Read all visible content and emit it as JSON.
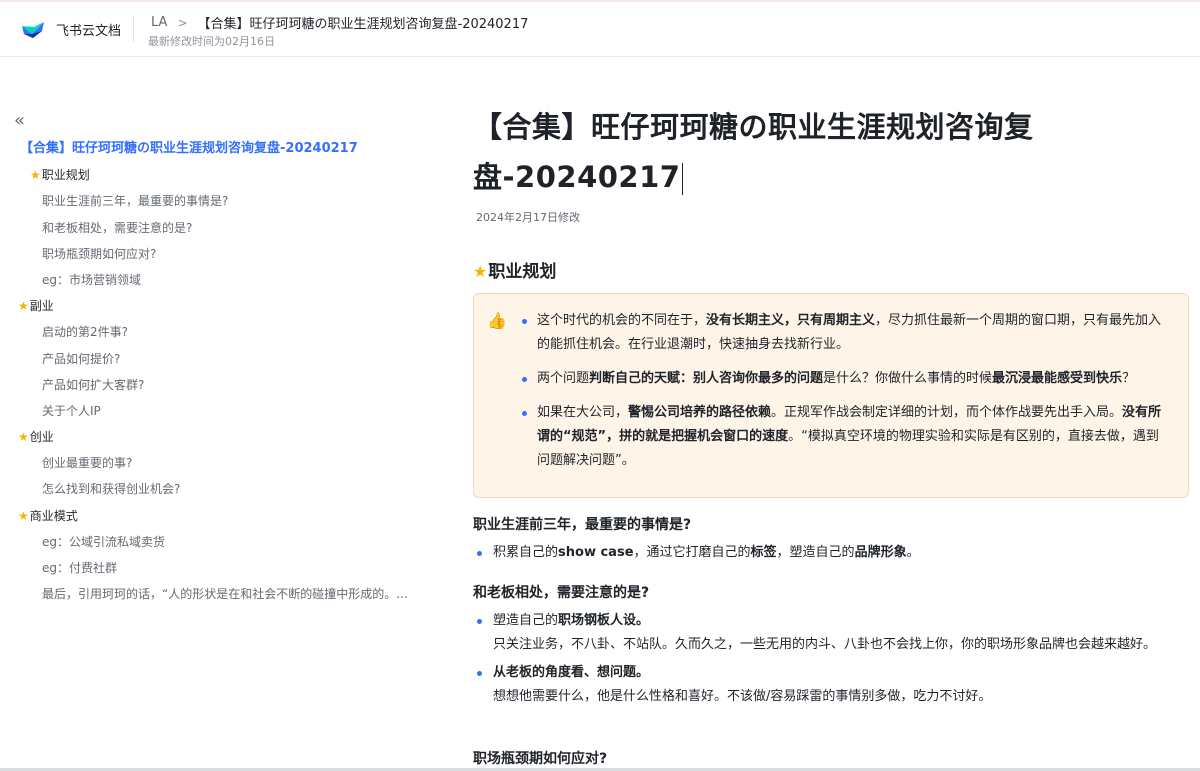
{
  "header": {
    "app_name": "飞书云文档",
    "breadcrumb_root": "LA",
    "breadcrumb_separator": ">",
    "breadcrumb_current": "【合集】旺仔珂珂糖の职业生涯规划咨询复盘-20240217",
    "modified": "最新修改时间为02月16日"
  },
  "toc": {
    "collapse_icon": "«",
    "items": [
      {
        "label": "【合集】旺仔珂珂糖の职业生涯规划咨询复盘-20240217",
        "level": 0
      },
      {
        "label": "职业规划",
        "level": 1,
        "star": true
      },
      {
        "label": "职业生涯前三年，最重要的事情是?",
        "level": 2
      },
      {
        "label": "和老板相处，需要注意的是?",
        "level": 2
      },
      {
        "label": "职场瓶颈期如何应对?",
        "level": 2
      },
      {
        "label": "eg：市场营销领域",
        "level": 2
      },
      {
        "label": "副业",
        "level": 1,
        "star": true
      },
      {
        "label": "启动的第2件事?",
        "level": 2
      },
      {
        "label": "产品如何提价?",
        "level": 2
      },
      {
        "label": "产品如何扩大客群?",
        "level": 2
      },
      {
        "label": "关于个人IP",
        "level": 2
      },
      {
        "label": "创业",
        "level": 1,
        "star": true
      },
      {
        "label": "创业最重要的事?",
        "level": 2
      },
      {
        "label": "怎么找到和获得创业机会?",
        "level": 2
      },
      {
        "label": "商业模式",
        "level": 1,
        "star": true
      },
      {
        "label": "eg：公域引流私域卖货",
        "level": 2
      },
      {
        "label": "eg：付费社群",
        "level": 2
      },
      {
        "label": "最后，引用珂珂的话，“人的形状是在和社会不断的碰撞中形成的。...",
        "level": 2
      }
    ]
  },
  "doc": {
    "title_line1": "【合集】旺仔珂珂糖の职业生涯规划咨询复",
    "title_line2": "盘-20240217",
    "date": "2024年2月17日修改",
    "section_title": "职业规划",
    "callout_icon": "👍",
    "callout": [
      {
        "t1": "这个时代的机会的不同在于，",
        "b1": "没有长期主义，只有周期主义",
        "t2": "，尽力抓住最新一个周期的窗口期，只有最先加入的能抓住机会。在行业退潮时，快速抽身去找新行业。"
      },
      {
        "t1": "两个问题",
        "b1": "判断自己的天赋：别人咨询你最多的问题",
        "t2": "是什么？你做什么事情的时候",
        "b2": "最沉浸最能感受到快乐",
        "t3": "？"
      },
      {
        "t1": "如果在大公司，",
        "b1": "警惕公司培养的路径依赖",
        "t2": "。正规军作战会制定详细的计划，而个体作战要先出手入局。",
        "b2": "没有所谓的“规范”，拼的就是把握机会窗口的速度",
        "t3": "。“模拟真空环境的物理实验和实际是有区别的，直接去做，遇到问题解决问题”。"
      }
    ],
    "s1": {
      "heading": "职业生涯前三年，最重要的事情是?",
      "t1": "积累自己的",
      "b1": "show case",
      "t2": "，通过它打磨自己的",
      "b2": "标签",
      "t3": "，塑造自己的",
      "b3": "品牌形象",
      "t4": "。"
    },
    "s2": {
      "heading": "和老板相处，需要注意的是?",
      "i1_t": "塑造自己的",
      "i1_b": "职场钢板人设",
      "i1_end": "。",
      "i1_sub": "只关注业务，不八卦、不站队。久而久之，一些无用的内斗、八卦也不会找上你，你的职场形象品牌也会越来越好。",
      "i2_b": "从老板的角度看、想问题",
      "i2_end": "。",
      "i2_sub": "想想他需要什么，他是什么性格和喜好。不该做/容易踩雷的事情别多做，吃力不讨好。"
    },
    "s3": {
      "heading": "职场瓶颈期如何应对?"
    }
  }
}
